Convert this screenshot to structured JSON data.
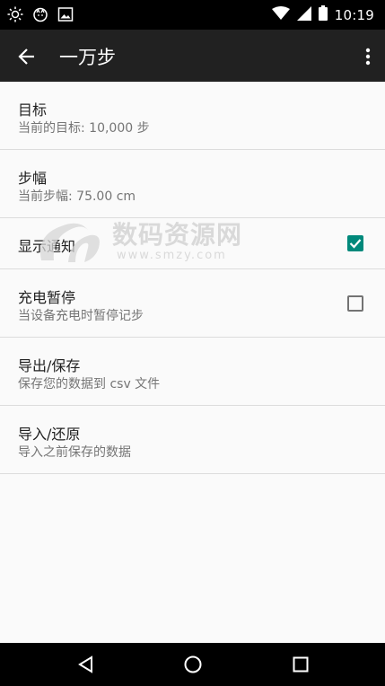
{
  "status_bar": {
    "time": "10:19",
    "icons": [
      "brightness-icon",
      "cat-icon",
      "image-icon",
      "wifi-icon",
      "signal-icon",
      "battery-icon"
    ]
  },
  "app_bar": {
    "title": "一万步"
  },
  "settings": [
    {
      "title": "目标",
      "summary": "当前的目标: 10,000 步"
    },
    {
      "title": "步幅",
      "summary": "当前步幅: 75.00 cm"
    },
    {
      "title": "显示通知",
      "checked": true
    },
    {
      "title": "充电暂停",
      "summary": "当设备充电时暂停记步",
      "checked": false
    },
    {
      "title": "导出/保存",
      "summary": "保存您的数据到 csv 文件"
    },
    {
      "title": "导入/还原",
      "summary": "导入之前保存的数据"
    }
  ],
  "watermark": {
    "text": "数码资源网",
    "url": "www.smzy.com"
  },
  "colors": {
    "status_bar": "#000000",
    "app_bar": "#212121",
    "background": "#fafafa",
    "accent": "#00897b",
    "divider": "#dcdcdc"
  }
}
